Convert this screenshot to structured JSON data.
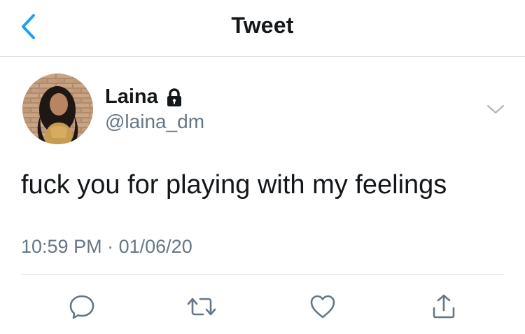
{
  "header": {
    "title": "Tweet",
    "back_icon": "chevron-left-icon"
  },
  "tweet": {
    "author": {
      "display_name": "Laina",
      "handle": "@laina_dm",
      "protected_icon": "lock-icon"
    },
    "text": "fuck you for playing with my feelings",
    "time": "10:59 PM",
    "separator": "·",
    "date": "01/06/20"
  },
  "actions": [
    {
      "name": "reply",
      "icon": "comment-icon"
    },
    {
      "name": "retweet",
      "icon": "retweet-icon"
    },
    {
      "name": "like",
      "icon": "heart-icon"
    },
    {
      "name": "share",
      "icon": "share-icon"
    }
  ],
  "colors": {
    "accent": "#1da1f2",
    "text": "#14171a",
    "secondary_text": "#657786",
    "divider": "#d8dde1",
    "icon": "#657786"
  }
}
